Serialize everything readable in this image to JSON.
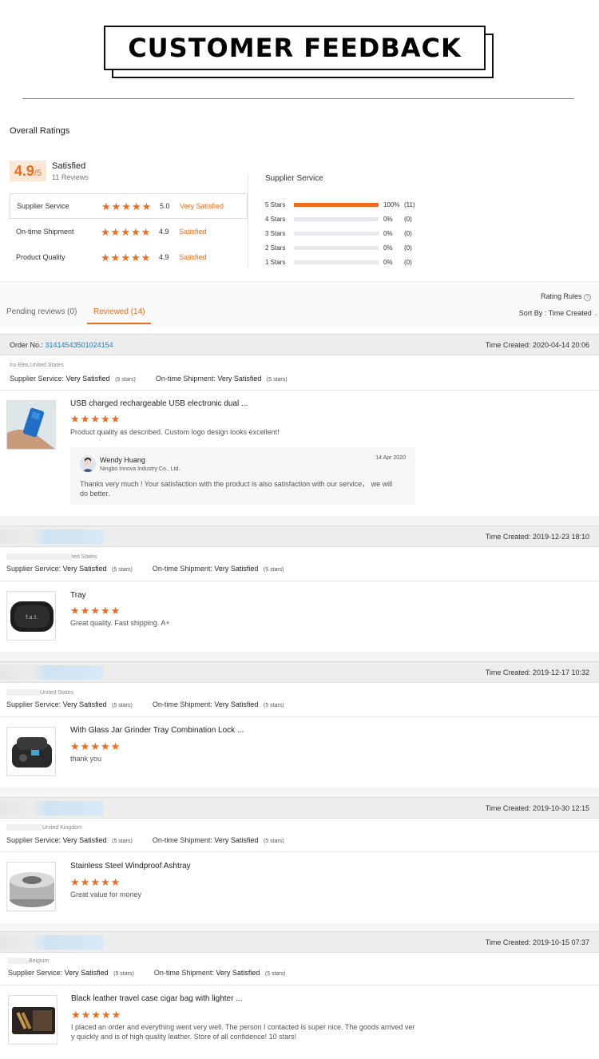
{
  "banner": {
    "title": "CUSTOMER FEEDBACK"
  },
  "overall": {
    "title": "Overall Ratings",
    "score": "4.9",
    "score_den": "/5",
    "label": "Satisfied",
    "reviews": "11 Reviews",
    "rows": [
      {
        "label": "Supplier Service",
        "value": "5.0",
        "text": "Very Satisfied",
        "stars": 5
      },
      {
        "label": "On-time Shipment",
        "value": "4.9",
        "text": "Satisfied",
        "stars": 5
      },
      {
        "label": "Product Quality",
        "value": "4.9",
        "text": "Satisfied",
        "stars": 5
      }
    ]
  },
  "supplier_service": {
    "title": "Supplier Service",
    "distribution": [
      {
        "label": "5  Stars",
        "fraction": 1.0,
        "pct": "100%",
        "count": "(11)"
      },
      {
        "label": "4  Stars",
        "fraction": 0,
        "pct": "0%",
        "count": "(0)"
      },
      {
        "label": "3  Stars",
        "fraction": 0,
        "pct": "0%",
        "count": "(0)"
      },
      {
        "label": "2  Stars",
        "fraction": 0,
        "pct": "0%",
        "count": "(0)"
      },
      {
        "label": "1  Stars",
        "fraction": 0,
        "pct": "0%",
        "count": "(0)"
      }
    ]
  },
  "tabs": {
    "pending": "Pending reviews (0)",
    "reviewed": "Reviewed (14)",
    "rating_rules": "Rating Rules",
    "sort_by": "Sort By : Time Created"
  },
  "colors": {
    "accent": "#f26b1d",
    "link": "#1a7ec6"
  },
  "reviews": [
    {
      "order_label": "Order No.:",
      "order_no": "31414543501024154",
      "time": "Time Created: 2020-04-14 20:06",
      "country": "Ira Eles,United States",
      "svc_label": "Supplier Service:",
      "svc_value": "Very Satisfied",
      "svc_stars": "(5 stars)",
      "ship_label": "On-time Shipment:",
      "ship_value": "Very Satisfied",
      "ship_stars": "(5 stars)",
      "title": "USB charged rechargeable USB electronic dual ...",
      "stars": 5,
      "comment": "Product quality as described. Custom logo design looks excellent!",
      "reply": {
        "name": "Wendy Huang",
        "company": "Ningbo Innova Industry Co., Ltd.",
        "date": "14 Apr 2020",
        "text": "Thanks very much ! Your satisfaction with the product is also satisfaction with our service，  we will do better."
      }
    },
    {
      "time": "Time Created: 2019-12-23 18:10",
      "country": "ted States",
      "svc_label": "Supplier Service:",
      "svc_value": "Very Satisfied",
      "svc_stars": "(5 stars)",
      "ship_label": "On-time Shipment:",
      "ship_value": "Very Satisfied",
      "ship_stars": "(5 stars)",
      "title": "Tray",
      "stars": 5,
      "comment": "Great quality. Fast shipping. A+"
    },
    {
      "time": "Time Created: 2019-12-17 10:32",
      "country": "United States",
      "svc_label": "Supplier Service:",
      "svc_value": "Very Satisfied",
      "svc_stars": "(5 stars)",
      "ship_label": "On-time Shipment:",
      "ship_value": "Very Satisfied",
      "ship_stars": "(5 stars)",
      "title": "With Glass Jar Grinder Tray Combination Lock ...",
      "stars": 5,
      "comment": "thank you"
    },
    {
      "time": "Time Created: 2019-10-30 12:15",
      "country": "United Kingdom",
      "svc_label": "Supplier Service:",
      "svc_value": "Very Satisfied",
      "svc_stars": "(5 stars)",
      "ship_label": "On-time Shipment:",
      "ship_value": "Very Satisfied",
      "ship_stars": "(5 stars)",
      "title": "Stainless Steel Windproof Ashtray",
      "stars": 5,
      "comment": "Great value for money"
    },
    {
      "time": "Time Created: 2019-10-15 07:37",
      "country": ",Belgium",
      "svc_label": "Supplier Service:",
      "svc_value": "Very Satisfied",
      "svc_stars": "(5 stars)",
      "ship_label": "On-time Shipment:",
      "ship_value": "Very Satisfied",
      "ship_stars": "(5 stars)",
      "title": "Black leather travel case cigar bag with lighter ...",
      "stars": 5,
      "comment_line1": "I placed an order and everything went very well. The person I contacted is super nice. The goods arrived ver",
      "comment_line2": "y quickly and is of high quality leather. Store of all confidence! 10 stars!"
    }
  ]
}
